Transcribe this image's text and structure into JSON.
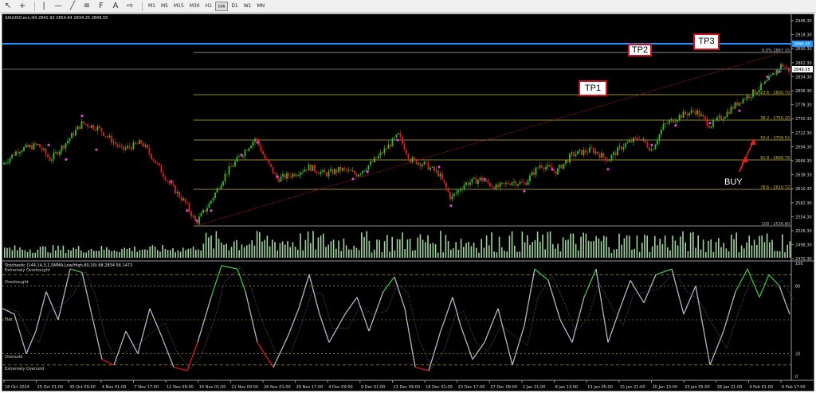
{
  "toolbar": {
    "icons": [
      "cursor-icon",
      "crosshair-icon",
      "vertical-line-icon",
      "horizontal-line-icon",
      "trendline-icon",
      "channel-icon",
      "fibonacci-icon",
      "text-icon",
      "arrow-shape-icon"
    ],
    "timeframes": [
      "M1",
      "M5",
      "M15",
      "M30",
      "H1",
      "H4",
      "D1",
      "W1",
      "MN"
    ],
    "active_timeframe": "H4"
  },
  "chart": {
    "title": "XAUUSD.ecn,H4  2841.93 2854.64 2834.25 2849.55",
    "price_ticks": [
      "2946.30",
      "2918.30",
      "2890.30",
      "2862.30",
      "2834.30",
      "2806.30",
      "2778.30",
      "2750.30",
      "2722.30",
      "2694.30",
      "2666.30",
      "2638.30",
      "2610.30",
      "2582.30",
      "2554.30",
      "2526.30",
      "2498.30",
      "2470.30"
    ],
    "blue_line_price": "2896.00",
    "current_price": "2849.55",
    "fib_levels": [
      {
        "label": "0.0% 2867.15",
        "color": "#b8b8b8"
      },
      {
        "label": "23.6 - 2800.70",
        "color": "#c9b63a"
      },
      {
        "label": "38.2 - 2750.20",
        "color": "#c9b63a"
      },
      {
        "label": "50.0 - 2709.52",
        "color": "#c9b63a"
      },
      {
        "label": "61.8 - 2668.78",
        "color": "#c9b63a"
      },
      {
        "label": "78.6 - 2610.72",
        "color": "#c9b63a"
      },
      {
        "label": "100 - 2536.80",
        "color": "#b8b8b8"
      }
    ],
    "annotations": {
      "tp1": "TP1",
      "tp2": "TP2",
      "tp3": "TP3",
      "buy": "BUY"
    },
    "colors": {
      "bull": "#2fbf2f",
      "bear": "#e02020",
      "stoch_main": "#aeb8c8",
      "stoch_overbought": "#3ec43e",
      "stoch_oversold": "#e01414",
      "blue_line": "#1e90ff"
    }
  },
  "stochastic": {
    "title": "Stochastic (144,14,3,1,SMMA,Low/High,80,20) 68.2834 56.1472",
    "level_labels": [
      "Extremely Overbought",
      "Overbought",
      "Flat",
      "Oversold",
      "Extremely Oversold"
    ],
    "ticks": [
      "100",
      "80",
      "20",
      "0"
    ]
  },
  "time_axis": [
    "18 Oct 2024",
    "25 Oct 01:00",
    "30 Oct 09:00",
    "4 Nov 01:00",
    "7 Nov 17:00",
    "11 Nov 09:00",
    "14 Nov 01:00",
    "21 Nov 09:00",
    "26 Nov 01:00",
    "29 Nov 17:00",
    "4 Dec 09:00",
    "9 Dec 01:00",
    "13 Dec 09:00",
    "18 Dec 01:00",
    "23 Dec 17:00",
    "27 Dec 09:00",
    "2 Jan 21:00",
    "8 Jan 13:00",
    "13 Jan 05:00",
    "15 Jan 21:00",
    "20 Jan 13:00",
    "23 Jan 05:00",
    "28 Jan 21:00",
    "4 Feb 01:00",
    "6 Feb 17:00"
  ]
}
